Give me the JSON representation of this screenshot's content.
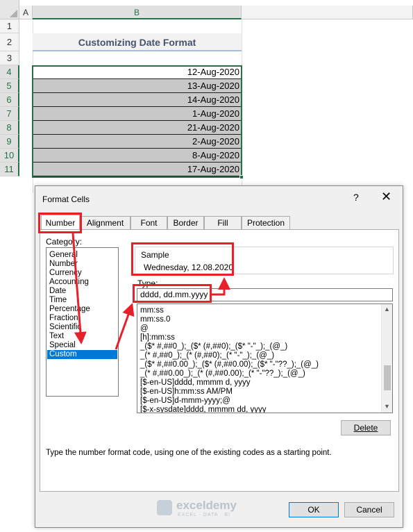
{
  "sheet": {
    "columns": [
      "A",
      "B"
    ],
    "rows": [
      "1",
      "2",
      "3",
      "4",
      "5",
      "6",
      "7",
      "8",
      "9",
      "10",
      "11"
    ],
    "title": "Customizing Date Format",
    "dates": [
      "12-Aug-2020",
      "13-Aug-2020",
      "14-Aug-2020",
      "1-Aug-2020",
      "21-Aug-2020",
      "2-Aug-2020",
      "8-Aug-2020",
      "17-Aug-2020"
    ]
  },
  "dialog": {
    "title": "Format Cells",
    "help": "?",
    "close": "✕",
    "tabs": [
      "Number",
      "Alignment",
      "Font",
      "Border",
      "Fill",
      "Protection"
    ],
    "category_label": "Category:",
    "categories": [
      "General",
      "Number",
      "Currency",
      "Accounting",
      "Date",
      "Time",
      "Percentage",
      "Fraction",
      "Scientific",
      "Text",
      "Special",
      "Custom"
    ],
    "selected_category": "Custom",
    "sample_label": "Sample",
    "sample_value": "Wednesday, 12.08.2020",
    "type_label": "Type:",
    "type_value": "dddd, dd.mm.yyyy",
    "formats": [
      "mm:ss",
      "mm:ss.0",
      "@",
      "[h]:mm:ss",
      "_($* #,##0_);_($* (#,##0);_($* \"-\"_);_(@_)",
      "_(* #,##0_);_(* (#,##0);_(* \"-\"_);_(@_)",
      "_($* #,##0.00_);_($* (#,##0.00);_($* \"-\"??_);_(@_)",
      "_(* #,##0.00_);_(* (#,##0.00);_(* \"-\"??_);_(@_)",
      "[$-en-US]dddd, mmmm d, yyyy",
      "[$-en-US]h:mm:ss AM/PM",
      "[$-en-US]d-mmm-yyyy;@",
      "[$-x-sysdate]dddd, mmmm dd, yyyy"
    ],
    "delete_label": "Delete",
    "hint": "Type the number format code, using one of the existing codes as a starting point.",
    "ok_label": "OK",
    "cancel_label": "Cancel"
  },
  "watermark": {
    "name": "exceldemy",
    "tagline": "EXCEL · DATA · BI"
  },
  "colors": {
    "highlight": "#e8202a",
    "selection": "#217346",
    "list_selected": "#0078d7"
  }
}
